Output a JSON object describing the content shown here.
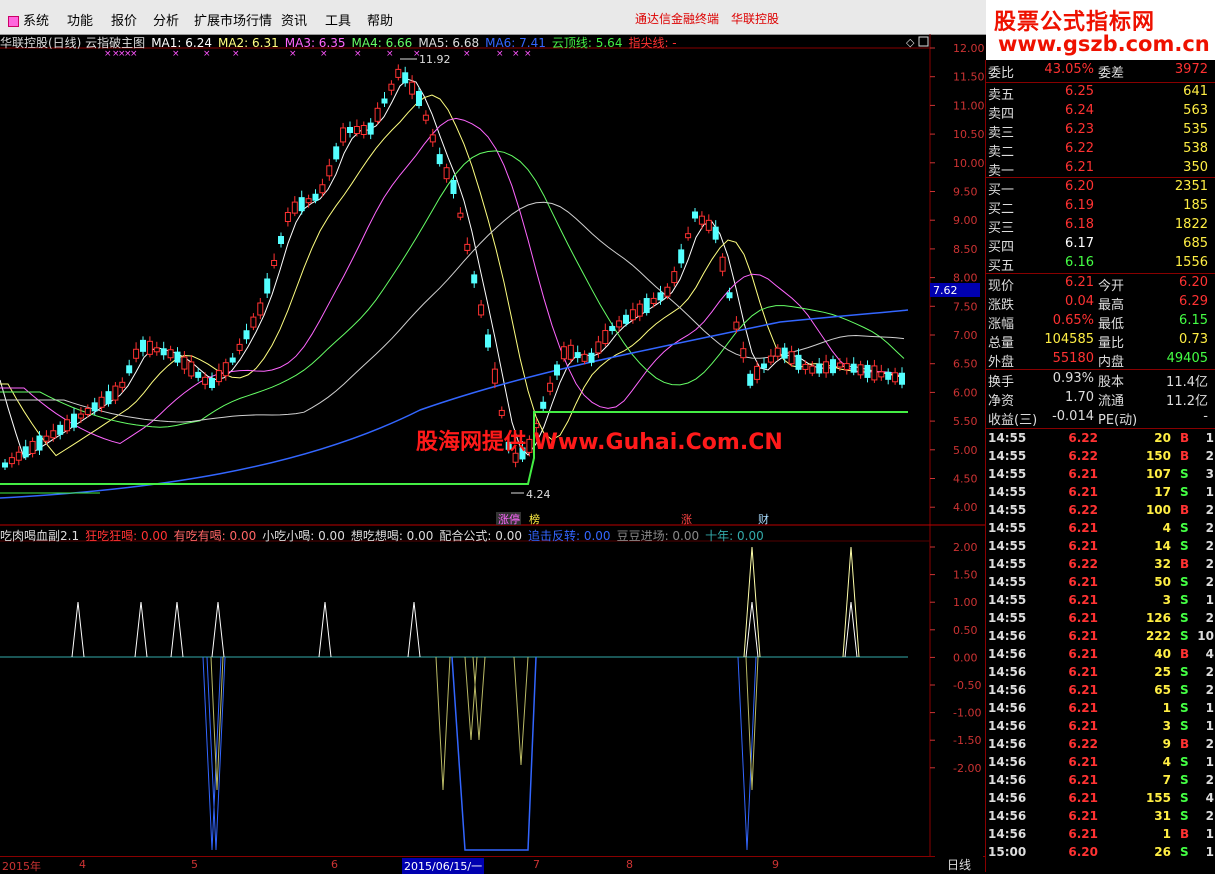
{
  "menu": {
    "items": [
      "系统",
      "功能",
      "报价",
      "分析",
      "扩展市场行情",
      "资讯",
      "工具",
      "帮助"
    ],
    "link1": "通达信金融终端",
    "link2": "华联控股"
  },
  "logo": {
    "line1": "股票公式指标网",
    "line2": "www.gszb.com.cn"
  },
  "main_chart": {
    "name": "华联控股(日线) 云指破主图",
    "ma1": "MA1: 6.24",
    "ma2": "MA2: 6.31",
    "ma3": "MA3: 6.35",
    "ma4": "MA4: 6.66",
    "ma5": "MA5: 6.68",
    "ma6": "MA6: 7.41",
    "cloud": "云顶线: 5.64",
    "tip": "指尖线: -",
    "high_label": "11.92",
    "low_label": "4.24",
    "side_price": "7.62",
    "y_ticks": [
      "12.00",
      "11.50",
      "11.00",
      "10.50",
      "10.00",
      "9.50",
      "9.00",
      "8.50",
      "8.00",
      "7.50",
      "7.00",
      "6.50",
      "6.00",
      "5.50",
      "5.00",
      "4.50",
      "4.00"
    ],
    "events": [
      "涨停",
      "榜",
      "涨",
      "财"
    ]
  },
  "sub_chart": {
    "name": "吃肉喝血副2.1",
    "v1": "狂吃狂喝: 0.00",
    "v2": "有吃有喝: 0.00",
    "v3": "小吃小喝: 0.00",
    "v4": "想吃想喝: 0.00",
    "v5": "配合公式: 0.00",
    "v6": "追击反转: 0.00",
    "v7": "豆豆进场: 0.00",
    "v8": "十年: 0.00",
    "y_ticks": [
      "2.00",
      "1.50",
      "1.00",
      "0.50",
      "0.00",
      "-0.50",
      "-1.00",
      "-1.50",
      "-2.00"
    ]
  },
  "watermark": "股海网提供 Www.Guhai.Com.CN",
  "timeline": {
    "labels": [
      "2015年",
      "4",
      "5",
      "6",
      "2015/06/15/一",
      "7",
      "8",
      "9"
    ],
    "period": "日线"
  },
  "quote": {
    "weibi": {
      "label": "委比",
      "value": "43.05%",
      "label2": "委差",
      "value2": "3972"
    },
    "sells": [
      {
        "label": "卖五",
        "price": "6.25",
        "vol": "641"
      },
      {
        "label": "卖四",
        "price": "6.24",
        "vol": "563"
      },
      {
        "label": "卖三",
        "price": "6.23",
        "vol": "535"
      },
      {
        "label": "卖二",
        "price": "6.22",
        "vol": "538"
      },
      {
        "label": "卖一",
        "price": "6.21",
        "vol": "350"
      }
    ],
    "buys": [
      {
        "label": "买一",
        "price": "6.20",
        "vol": "2351"
      },
      {
        "label": "买二",
        "price": "6.19",
        "vol": "185"
      },
      {
        "label": "买三",
        "price": "6.18",
        "vol": "1822"
      },
      {
        "label": "买四",
        "price": "6.17",
        "vol": "685"
      },
      {
        "label": "买五",
        "price": "6.16",
        "vol": "1556"
      }
    ],
    "stats": [
      {
        "l1": "现价",
        "v1": "6.21",
        "l2": "今开",
        "v2": "6.20"
      },
      {
        "l1": "涨跌",
        "v1": "0.04",
        "l2": "最高",
        "v2": "6.29"
      },
      {
        "l1": "涨幅",
        "v1": "0.65%",
        "l2": "最低",
        "v2": "6.15"
      },
      {
        "l1": "总量",
        "v1": "104585",
        "l2": "量比",
        "v2": "0.73"
      },
      {
        "l1": "外盘",
        "v1": "55180",
        "l2": "内盘",
        "v2": "49405"
      }
    ],
    "stats2": [
      {
        "l1": "换手",
        "v1": "0.93%",
        "l2": "股本",
        "v2": "11.4亿"
      },
      {
        "l1": "净资",
        "v1": "1.70",
        "l2": "流通",
        "v2": "11.2亿"
      },
      {
        "l1": "收益(三)",
        "v1": "-0.014",
        "l2": "PE(动)",
        "v2": "-"
      }
    ]
  },
  "ticks": [
    {
      "t": "14:55",
      "p": "6.22",
      "v": "20",
      "s": "B",
      "n": "1"
    },
    {
      "t": "14:55",
      "p": "6.22",
      "v": "150",
      "s": "B",
      "n": "2"
    },
    {
      "t": "14:55",
      "p": "6.21",
      "v": "107",
      "s": "S",
      "n": "3"
    },
    {
      "t": "14:55",
      "p": "6.21",
      "v": "17",
      "s": "S",
      "n": "1"
    },
    {
      "t": "14:55",
      "p": "6.22",
      "v": "100",
      "s": "B",
      "n": "2"
    },
    {
      "t": "14:55",
      "p": "6.21",
      "v": "4",
      "s": "S",
      "n": "2"
    },
    {
      "t": "14:55",
      "p": "6.21",
      "v": "14",
      "s": "S",
      "n": "2"
    },
    {
      "t": "14:55",
      "p": "6.22",
      "v": "32",
      "s": "B",
      "n": "2"
    },
    {
      "t": "14:55",
      "p": "6.21",
      "v": "50",
      "s": "S",
      "n": "2"
    },
    {
      "t": "14:55",
      "p": "6.21",
      "v": "3",
      "s": "S",
      "n": "1"
    },
    {
      "t": "14:55",
      "p": "6.21",
      "v": "126",
      "s": "S",
      "n": "2"
    },
    {
      "t": "14:56",
      "p": "6.21",
      "v": "222",
      "s": "S",
      "n": "10"
    },
    {
      "t": "14:56",
      "p": "6.21",
      "v": "40",
      "s": "B",
      "n": "4"
    },
    {
      "t": "14:56",
      "p": "6.21",
      "v": "25",
      "s": "S",
      "n": "2"
    },
    {
      "t": "14:56",
      "p": "6.21",
      "v": "65",
      "s": "S",
      "n": "2"
    },
    {
      "t": "14:56",
      "p": "6.21",
      "v": "1",
      "s": "S",
      "n": "1"
    },
    {
      "t": "14:56",
      "p": "6.21",
      "v": "3",
      "s": "S",
      "n": "1"
    },
    {
      "t": "14:56",
      "p": "6.22",
      "v": "9",
      "s": "B",
      "n": "2"
    },
    {
      "t": "14:56",
      "p": "6.21",
      "v": "4",
      "s": "S",
      "n": "1"
    },
    {
      "t": "14:56",
      "p": "6.21",
      "v": "7",
      "s": "S",
      "n": "2"
    },
    {
      "t": "14:56",
      "p": "6.21",
      "v": "155",
      "s": "S",
      "n": "4"
    },
    {
      "t": "14:56",
      "p": "6.21",
      "v": "31",
      "s": "S",
      "n": "2"
    },
    {
      "t": "14:56",
      "p": "6.21",
      "v": "1",
      "s": "B",
      "n": "1"
    },
    {
      "t": "15:00",
      "p": "6.20",
      "v": "26",
      "s": "S",
      "n": "1"
    }
  ],
  "colors": {
    "up": "#ff3232",
    "down": "#54ffff",
    "ma1": "#ffffff",
    "ma2": "#ffff80",
    "ma3": "#ff66ff",
    "ma4": "#66ff66",
    "ma5": "#d0d0d0",
    "ma6": "#3366ff",
    "cloud": "#44ee44"
  }
}
